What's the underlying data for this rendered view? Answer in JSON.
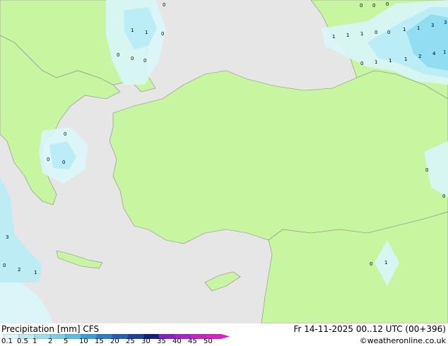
{
  "footer": {
    "title": "Precipitation [mm]  CFS",
    "valid_time": "Fr 14-11-2025 00..12 UTC (00+396)",
    "credit": "©weatheronline.co.uk"
  },
  "legend": {
    "labels": [
      "0.1",
      "0.5",
      "1",
      "2",
      "5",
      "10",
      "15",
      "20",
      "25",
      "30",
      "35",
      "40",
      "45",
      "50"
    ],
    "colors": [
      "#d9f6fa",
      "#b8ecf6",
      "#97e2f2",
      "#6fd2ee",
      "#4ec0ec",
      "#2f9fe8",
      "#1f7fdd",
      "#1c5fc8",
      "#1a3fae",
      "#0d1f8e",
      "#8a1ad6",
      "#b01ad8",
      "#d21ad8",
      "#e21ad8"
    ]
  },
  "map_values": [
    "0",
    "1",
    "1",
    "0",
    "0",
    "0",
    "0",
    "0",
    "1",
    "1",
    "1",
    "0",
    "1",
    "1",
    "3",
    "3",
    "4",
    "2",
    "1",
    "1",
    "1",
    "0",
    "0",
    "1",
    "0",
    "0",
    "0",
    "0",
    "0",
    "3",
    "0",
    "2",
    "1",
    "0",
    "1",
    "0",
    "0"
  ],
  "colors": {
    "sea": "#e6e6e6",
    "land": "#c8f5a0",
    "precip_light": "#d9f6fa",
    "precip_mid": "#b8ecf6",
    "precip_high": "#8fdcf1"
  }
}
